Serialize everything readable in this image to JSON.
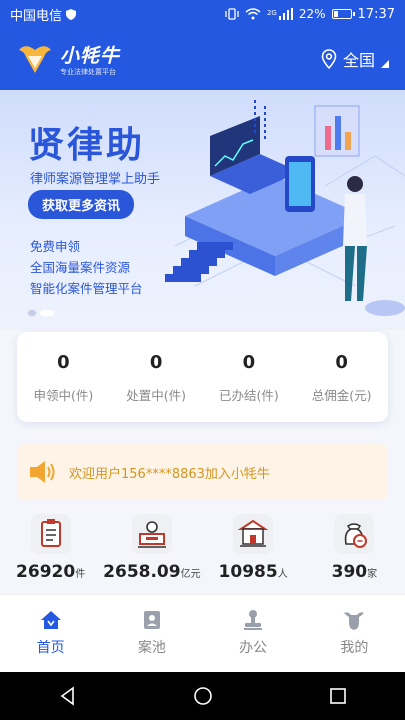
{
  "status_bar": {
    "carrier": "中国电信",
    "signal_tag": "2G",
    "battery": "22%",
    "battery_level": 0.22,
    "time": "17:37"
  },
  "header": {
    "app_name": "小牦牛",
    "slogan": "专业法律处置平台",
    "region": "全国"
  },
  "banner": {
    "title": "贤律助",
    "subtitle": "律师案源管理掌上助手",
    "cta": "获取更多资讯",
    "features": [
      "免费申领",
      "全国海量案件资源",
      "智能化案件管理平台"
    ],
    "slide_count": 2,
    "active_slide": 2
  },
  "stats": [
    {
      "value": "0",
      "label": "申领中(件)"
    },
    {
      "value": "0",
      "label": "处置中(件)"
    },
    {
      "value": "0",
      "label": "已办结(件)"
    },
    {
      "value": "0",
      "label": "总佣金(元)"
    }
  ],
  "notice": {
    "text": "欢迎用户156****8863加入小牦牛"
  },
  "metrics": [
    {
      "icon": "document-list-icon",
      "value": "26920",
      "unit": "件"
    },
    {
      "icon": "lawyer-desk-icon",
      "value": "2658.09",
      "unit": "亿元"
    },
    {
      "icon": "court-building-icon",
      "value": "10985",
      "unit": "人"
    },
    {
      "icon": "money-bag-icon",
      "value": "390",
      "unit": "家"
    }
  ],
  "tabs": [
    {
      "label": "首页",
      "icon": "home-icon",
      "active": true
    },
    {
      "label": "案池",
      "icon": "case-pool-icon",
      "active": false
    },
    {
      "label": "办公",
      "icon": "office-icon",
      "active": false
    },
    {
      "label": "我的",
      "icon": "profile-icon",
      "active": false
    }
  ],
  "colors": {
    "brand_blue": "#2458e0",
    "notice_text": "#d7951c",
    "notice_bg": "#fdf4e7"
  }
}
